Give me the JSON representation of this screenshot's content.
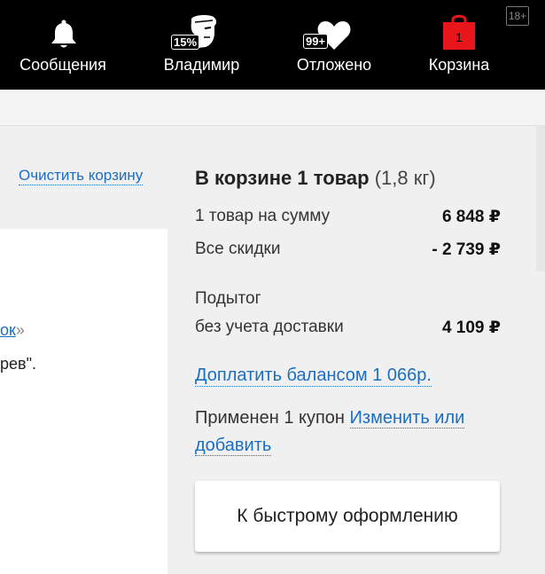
{
  "header": {
    "messages": {
      "label": "Сообщения",
      "icon": "bell-icon"
    },
    "profile": {
      "label": "Владимир",
      "icon": "user-avatar-icon",
      "badge": "15%"
    },
    "favorites": {
      "label": "Отложено",
      "icon": "heart-icon",
      "badge": "99+"
    },
    "cart": {
      "label": "Корзина",
      "icon": "shopping-bag-icon",
      "count": "1"
    },
    "age_rating": "18+"
  },
  "content": {
    "clear_cart": "Очистить корзину",
    "fragment_link": "ок",
    "fragment_quote": "»",
    "fragment_text": "рев\"."
  },
  "summary": {
    "title_bold": "В корзине 1 товар",
    "title_weight": "(1,8 кг)",
    "items_label": "1 товар на сумму",
    "items_value": "6 848 ₽",
    "discounts_label": "Все скидки",
    "discounts_value": "- 2 739 ₽",
    "subtotal_label": "Подытог",
    "subtotal_sublabel": "без учета доставки",
    "subtotal_value": "4 109 ₽",
    "balance_link": "Доплатить балансом 1 066р.",
    "coupon_text": "Применен 1 купон",
    "coupon_link": "Изменить или добавить",
    "checkout_button": "К быстрому оформлению"
  },
  "colors": {
    "header_bg": "#000000",
    "link": "#1a6fc2",
    "cart_icon": "#e8151b",
    "page_bg": "#f0f0f0"
  }
}
